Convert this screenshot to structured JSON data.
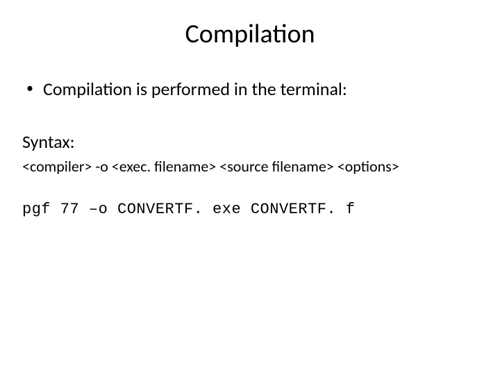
{
  "title": "Compilation",
  "bullet": "Compilation is performed in the terminal:",
  "syntax_label": "Syntax:",
  "syntax_line": "<compiler> -o <exec. filename> <source filename> <options>",
  "code_line": "pgf 77 –o CONVERTF. exe CONVERTF. f"
}
